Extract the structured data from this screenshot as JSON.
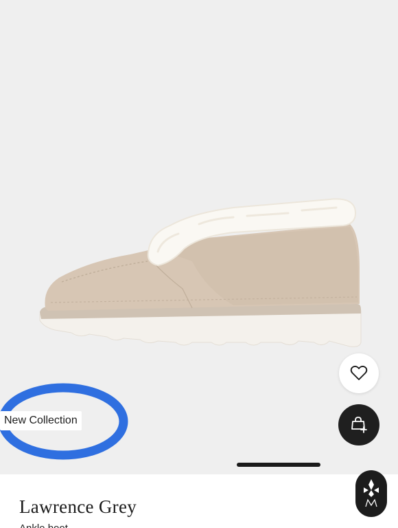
{
  "product": {
    "name": "Lawrence Grey",
    "subtitle": "Ankle boot",
    "badge": "New Collection",
    "image_icon": "suede-shoe-with-shearling-image"
  },
  "actions": {
    "wishlist_icon": "heart-icon",
    "cart_icon": "bag-plus-icon"
  },
  "brand": {
    "logo_icon": "brand-monogram-logo"
  },
  "colors": {
    "background": "#efefef",
    "panel": "#ffffff",
    "accent_ring": "#2f6fe0",
    "dark_button": "#1f1f1f",
    "suede": "#d7c6b4",
    "shearling": "#faf8f3"
  }
}
